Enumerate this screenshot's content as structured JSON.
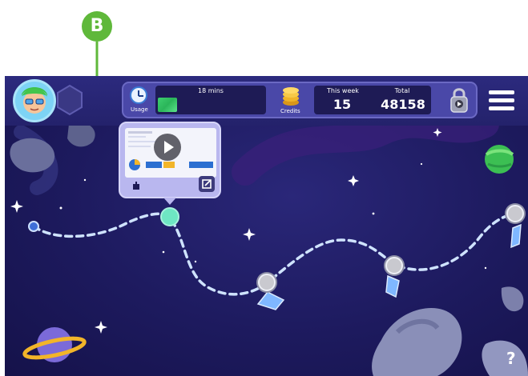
{
  "annotation": {
    "label": "B",
    "color": "#5fb83a"
  },
  "hud": {
    "usage_label": "Usage",
    "usage_mins": "18 mins",
    "usage_fraction": 0.18,
    "credits_label": "Credits",
    "this_week_label": "This week",
    "total_label": "Total",
    "this_week_value": "15",
    "total_value": "48158"
  },
  "icons": {
    "avatar": "avatar-icon",
    "hexagon": "hexagon-badge-icon",
    "clock": "clock-icon",
    "coins": "coins-icon",
    "lock": "padlock-icon",
    "menu": "hamburger-menu-icon",
    "play": "play-icon",
    "edit": "edit-icon",
    "help": "?"
  },
  "colors": {
    "space_bg": "#1d1a5e",
    "path": "#cfe3ff",
    "active_node": "#6ee6c3",
    "card": "#b9b7ef"
  }
}
